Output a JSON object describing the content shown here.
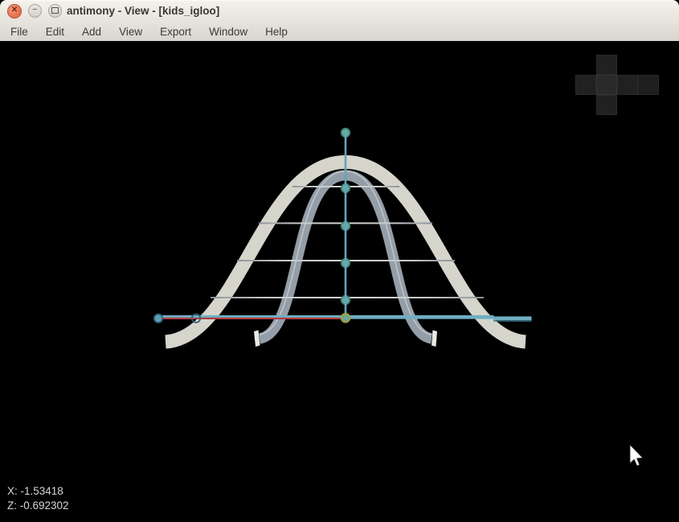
{
  "window": {
    "title": "antimony - View - [kids_igloo]"
  },
  "titlebar_controls": {
    "close_glyph": "✕",
    "minimize_glyph": "−"
  },
  "menubar": {
    "items": [
      {
        "label": "File"
      },
      {
        "label": "Edit"
      },
      {
        "label": "Add"
      },
      {
        "label": "View"
      },
      {
        "label": "Export"
      },
      {
        "label": "Window"
      },
      {
        "label": "Help"
      }
    ]
  },
  "viewport": {
    "status": {
      "line1": "X: -1.53418",
      "line2": "Z: -0.692302"
    },
    "icons": {
      "view_cube": "unfolded-cube-view-widget",
      "cursor": "mouse-pointer-arrow"
    },
    "colors": {
      "background": "#000000",
      "axis_teal": "#6faec2",
      "axis_vertical": "#63a5ba",
      "axis_red": "#b1383f",
      "point_fill": "#6cab9f",
      "point_stroke": "#3c8177",
      "selected_point_ring": "#a0a23c",
      "outer_arch": "#d6d5cc",
      "inner_arch": "#949ea8",
      "grid_line": "#c6c9c8"
    }
  }
}
